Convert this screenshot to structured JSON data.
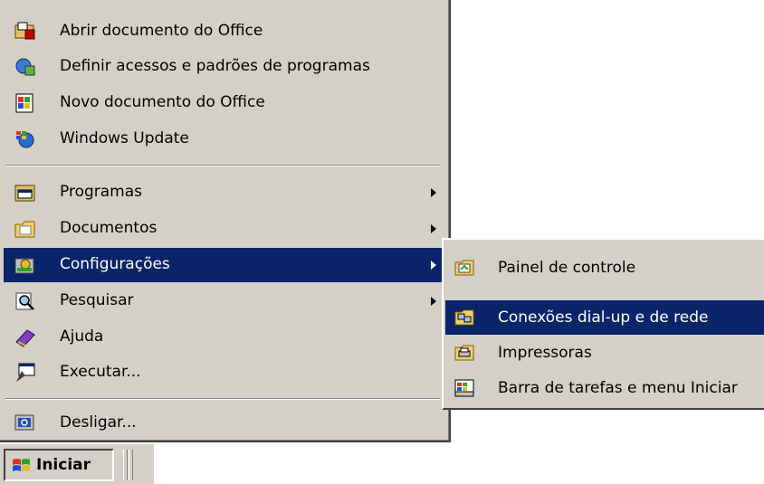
{
  "start_menu": {
    "top_items": [
      {
        "label": "Abrir documento do Office",
        "icon": "open-office-document-icon"
      },
      {
        "label": "Definir acessos e padrões de programas",
        "icon": "program-defaults-icon"
      },
      {
        "label": "Novo documento do Office",
        "icon": "new-office-document-icon"
      },
      {
        "label": "Windows Update",
        "icon": "windows-update-icon"
      }
    ],
    "items": [
      {
        "label": "Programas",
        "icon": "programs-folder-icon",
        "submenu": true
      },
      {
        "label": "Documentos",
        "icon": "documents-folder-icon",
        "submenu": true
      },
      {
        "label": "Configurações",
        "icon": "settings-icon",
        "submenu": true,
        "selected": true
      },
      {
        "label": "Pesquisar",
        "icon": "search-icon",
        "submenu": true
      },
      {
        "label": "Ajuda",
        "icon": "help-book-icon"
      },
      {
        "label": "Executar...",
        "icon": "run-icon"
      }
    ],
    "bottom_items": [
      {
        "label": "Desligar...",
        "icon": "shutdown-icon"
      }
    ]
  },
  "settings_submenu": {
    "items": [
      {
        "label": "Painel de controle",
        "icon": "control-panel-icon"
      },
      {
        "label": "Conexões dial-up e de rede",
        "icon": "network-connections-icon",
        "selected": true
      },
      {
        "label": "Impressoras",
        "icon": "printers-icon"
      },
      {
        "label": "Barra de tarefas e menu Iniciar",
        "icon": "taskbar-start-menu-icon"
      }
    ]
  },
  "taskbar": {
    "start_label": "Iniciar",
    "start_icon": "windows-flag-icon"
  },
  "colors": {
    "menu_bg": "#d4d0c8",
    "highlight": "#0a246a",
    "highlight_text": "#ffffff"
  }
}
